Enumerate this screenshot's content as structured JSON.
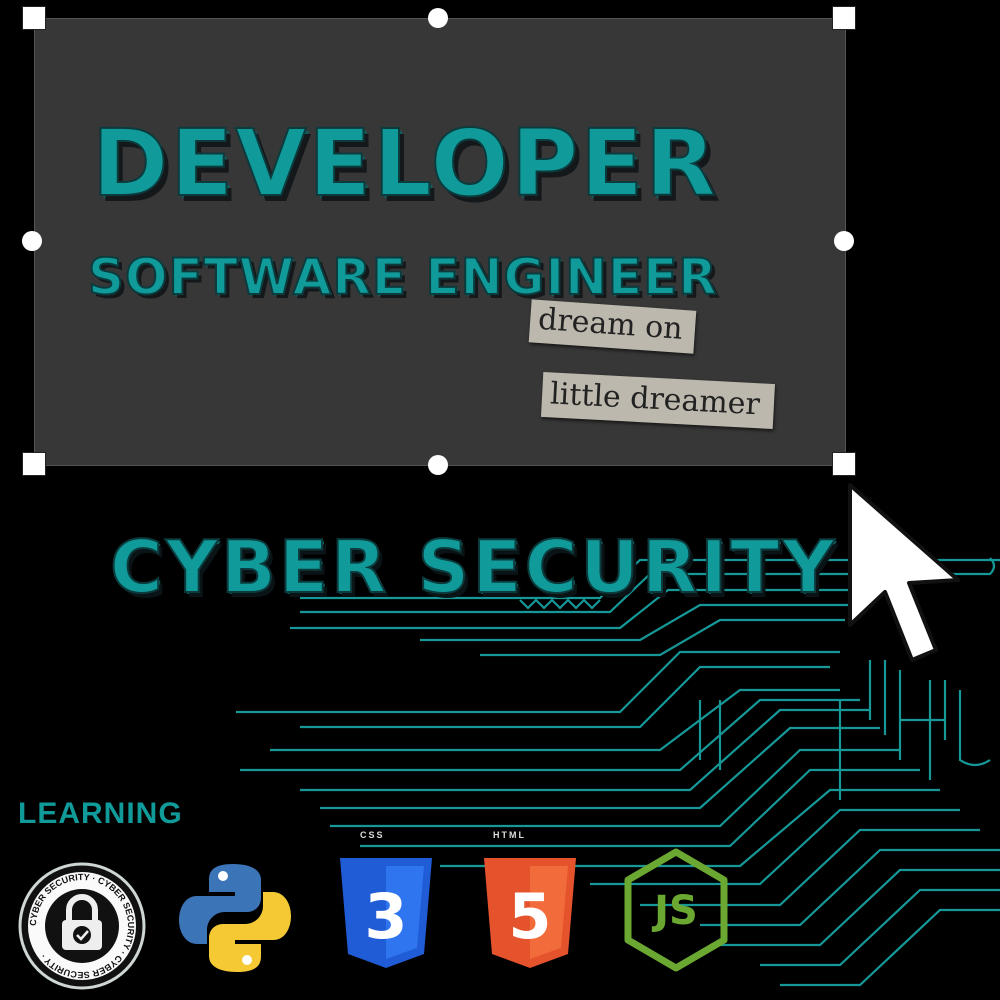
{
  "titles": {
    "developer": "DEVELOPER",
    "software_engineer": "SOFTWARE ENGINEER",
    "cyber_security": "CYBER SECURITY"
  },
  "notes": {
    "line1": "dream on",
    "line2": "little dreamer"
  },
  "learning": {
    "label": "LEARNING",
    "badge_text": "CYBER SECURITY · CYBER SECURITY · CYBER SECURITY ·",
    "css_label": "CSS",
    "html_label": "HTML",
    "css_badge_digit": "3",
    "html_badge_digit": "5",
    "nodejs_text": "JS",
    "icons": [
      "cyber-security-badge-icon",
      "python-icon",
      "css3-icon",
      "html5-icon",
      "nodejs-icon"
    ]
  },
  "colors": {
    "accent": "#119a9a",
    "panel": "#373737",
    "background": "#000000",
    "css_blue": "#1f5cd6",
    "html_orange": "#e5532d",
    "node_green": "#6aa832"
  }
}
